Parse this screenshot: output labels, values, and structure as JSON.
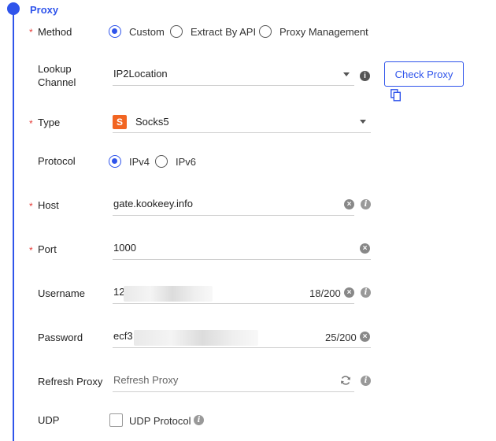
{
  "section": {
    "title": "Proxy"
  },
  "method": {
    "label": "Method",
    "options": [
      "Custom",
      "Extract By API",
      "Proxy Management"
    ],
    "selected": "Custom"
  },
  "lookup": {
    "label": "Lookup Channel",
    "label_line1": "Lookup",
    "label_line2": "Channel",
    "value": "IP2Location",
    "check_button": "Check Proxy"
  },
  "type": {
    "label": "Type",
    "value": "Socks5",
    "icon_letter": "S"
  },
  "protocol": {
    "label": "Protocol",
    "options": [
      "IPv4",
      "IPv6"
    ],
    "selected": "IPv4"
  },
  "host": {
    "label": "Host",
    "value": "gate.kookeey.info"
  },
  "port": {
    "label": "Port",
    "value": "1000"
  },
  "username": {
    "label": "Username",
    "value_prefix": "12",
    "counter": "18/200"
  },
  "password": {
    "label": "Password",
    "value_prefix": "ecf3",
    "counter": "25/200"
  },
  "refresh": {
    "label": "Refresh Proxy",
    "placeholder": "Refresh Proxy"
  },
  "udp": {
    "label": "UDP",
    "checkbox_label": "UDP Protocol",
    "checked": false
  },
  "required_mark": "*",
  "colors": {
    "accent": "#2f54eb",
    "required": "#e53935",
    "socks_icon": "#f26522"
  }
}
